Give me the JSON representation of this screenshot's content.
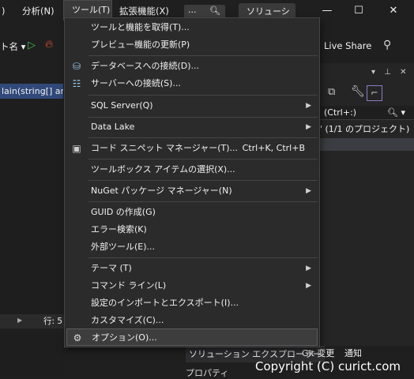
{
  "menubar": {
    "items": [
      ")",
      "分析(N)",
      "ツール(T)",
      "拡張機能(X)"
    ],
    "search_dots": "...",
    "solution_label": "ソリューション名",
    "min": "—",
    "max": "☐",
    "close": "✕"
  },
  "toolbar": {
    "name_fragment": "ト名 ▾",
    "live_share": "Live Share"
  },
  "editor": {
    "tab_label": "lain(string[] arg",
    "line_label": "行: 5"
  },
  "right_panel": {
    "search_text": "(Ctrl+:)",
    "solution_text": "' (1/1 のプロジェクト)"
  },
  "bottom": {
    "tab_solution_explorer": "ソリューション エクスプローラー",
    "tab_git": "Git 変更",
    "tab_notifications": "通知",
    "properties_fragment": "プロパティ"
  },
  "dropdown": {
    "items": [
      {
        "label": "ツールと機能を取得(T)...",
        "shortcut": "",
        "submenu": false,
        "icon": ""
      },
      {
        "label": "プレビュー機能の更新(P)",
        "shortcut": "",
        "submenu": false,
        "icon": ""
      },
      {
        "label": "データベースへの接続(D)...",
        "shortcut": "",
        "submenu": false,
        "icon": "database-connect-icon"
      },
      {
        "label": "サーバーへの接続(S)...",
        "shortcut": "",
        "submenu": false,
        "icon": "server-connect-icon"
      },
      {
        "label": "SQL Server(Q)",
        "shortcut": "",
        "submenu": true,
        "icon": ""
      },
      {
        "label": "Data Lake",
        "shortcut": "",
        "submenu": true,
        "icon": ""
      },
      {
        "label": "コード スニペット マネージャー(T)...",
        "shortcut": "Ctrl+K, Ctrl+B",
        "submenu": false,
        "icon": "snippet-icon"
      },
      {
        "label": "ツールボックス アイテムの選択(X)...",
        "shortcut": "",
        "submenu": false,
        "icon": ""
      },
      {
        "label": "NuGet パッケージ マネージャー(N)",
        "shortcut": "",
        "submenu": true,
        "icon": ""
      },
      {
        "label": "GUID の作成(G)",
        "shortcut": "",
        "submenu": false,
        "icon": ""
      },
      {
        "label": "エラー検索(K)",
        "shortcut": "",
        "submenu": false,
        "icon": ""
      },
      {
        "label": "外部ツール(E)...",
        "shortcut": "",
        "submenu": false,
        "icon": ""
      },
      {
        "label": "テーマ (T)",
        "shortcut": "",
        "submenu": true,
        "icon": ""
      },
      {
        "label": "コマンド ライン(L)",
        "shortcut": "",
        "submenu": true,
        "icon": ""
      },
      {
        "label": "設定のインポートとエクスポート(I)...",
        "shortcut": "",
        "submenu": false,
        "icon": ""
      },
      {
        "label": "カスタマイズ(C)...",
        "shortcut": "",
        "submenu": false,
        "icon": ""
      },
      {
        "label": "オプション(O)...",
        "shortcut": "",
        "submenu": false,
        "icon": "gear-icon"
      }
    ]
  },
  "watermark": "Copyright (C) curict.com",
  "colors": {
    "background": "#1f1f1f",
    "menu_bg": "#2b2b2b",
    "highlight": "#3d3d3d",
    "run_green": "#3fb950",
    "accent_purple": "#8e7cc3"
  }
}
